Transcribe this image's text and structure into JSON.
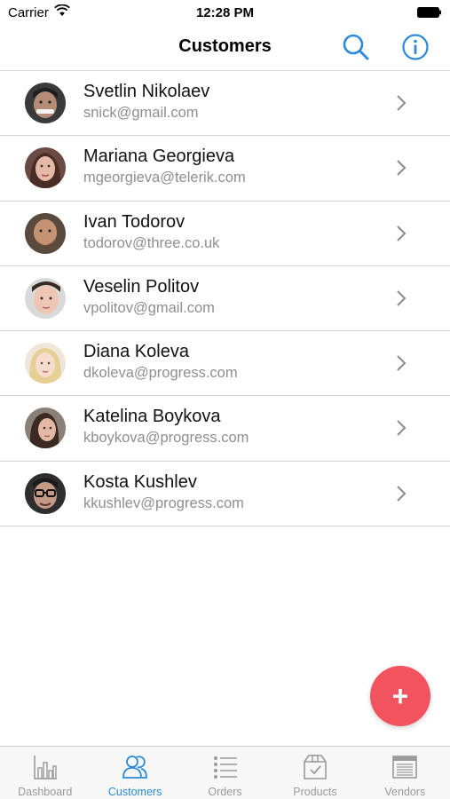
{
  "status_bar": {
    "carrier": "Carrier",
    "time": "12:28 PM"
  },
  "nav": {
    "title": "Customers",
    "search_icon": "search-icon",
    "info_icon": "info-icon"
  },
  "colors": {
    "accent": "#2d8ad8",
    "fab": "#f2545f",
    "secondary_text": "#8e8e93"
  },
  "customers": [
    {
      "name": "Svetlin Nikolaev",
      "email": "snick@gmail.com"
    },
    {
      "name": "Mariana Georgieva",
      "email": "mgeorgieva@telerik.com"
    },
    {
      "name": "Ivan Todorov",
      "email": "todorov@three.co.uk"
    },
    {
      "name": "Veselin Politov",
      "email": "vpolitov@gmail.com"
    },
    {
      "name": "Diana Koleva",
      "email": "dkoleva@progress.com"
    },
    {
      "name": "Katelina Boykova",
      "email": "kboykova@progress.com"
    },
    {
      "name": "Kosta Kushlev",
      "email": "kkushlev@progress.com"
    }
  ],
  "fab": {
    "icon": "plus-icon",
    "label": "+"
  },
  "tabs": [
    {
      "label": "Dashboard",
      "icon": "bar-chart-icon",
      "active": false
    },
    {
      "label": "Customers",
      "icon": "users-icon",
      "active": true
    },
    {
      "label": "Orders",
      "icon": "list-icon",
      "active": false
    },
    {
      "label": "Products",
      "icon": "box-icon",
      "active": false
    },
    {
      "label": "Vendors",
      "icon": "receipt-icon",
      "active": false
    }
  ]
}
